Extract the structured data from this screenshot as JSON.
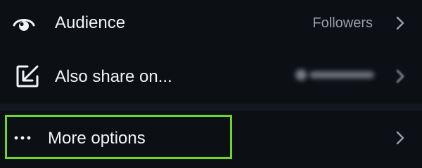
{
  "settings": {
    "audience": {
      "label": "Audience",
      "value": "Followers",
      "icon": "eye-icon"
    },
    "also_share": {
      "label": "Also share on...",
      "icon": "share-arrow-icon",
      "account_redacted": true
    },
    "more_options": {
      "label": "More options",
      "icon": "more-horizontal-icon",
      "highlighted": true
    }
  },
  "colors": {
    "background": "#0c0f14",
    "text": "#f3f4f6",
    "muted_text": "#9a9ea6",
    "highlight": "#6dd81c"
  }
}
